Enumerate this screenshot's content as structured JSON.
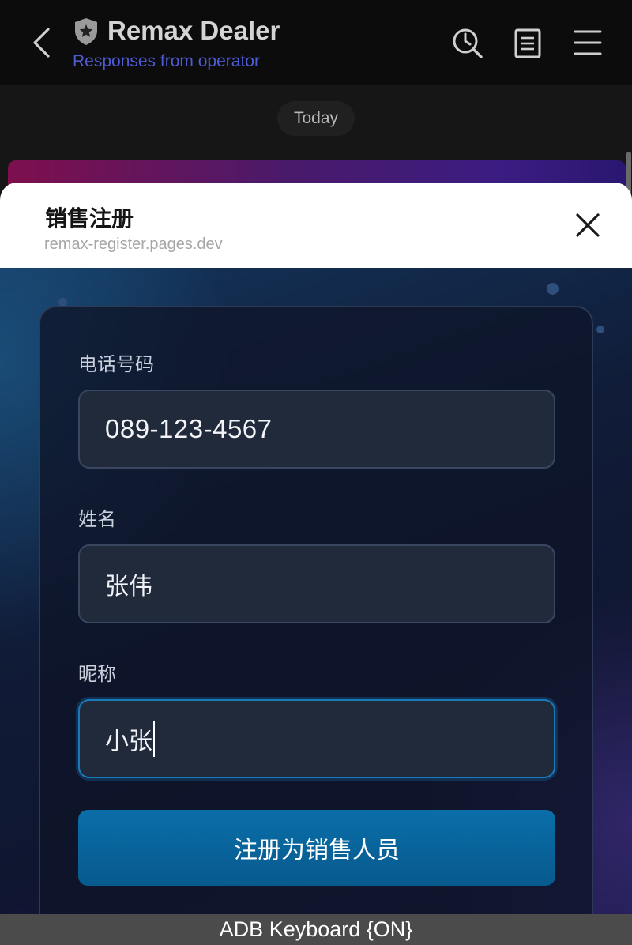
{
  "chat_header": {
    "title": "Remax Dealer",
    "subtitle": "Responses from operator",
    "icons": [
      "chevron-left-icon",
      "shield-star-icon",
      "history-search-icon",
      "document-icon",
      "menu-icon"
    ]
  },
  "chat": {
    "date_divider": "Today"
  },
  "sheet": {
    "title": "销售注册",
    "url": "remax-register.pages.dev",
    "close_icon": "close-icon"
  },
  "form": {
    "phone": {
      "label": "电话号码",
      "value": "089-123-4567"
    },
    "name": {
      "label": "姓名",
      "value": "张伟"
    },
    "nickname": {
      "label": "昵称",
      "value": "小张"
    },
    "submit_label": "注册为销售人员"
  },
  "keyboard_status": "ADB Keyboard {ON}",
  "colors": {
    "header_bg": "#0c0c0c",
    "subtitle": "#4f5bd4",
    "sheet_header_bg": "#ffffff",
    "input_bg": "#212a3b",
    "input_focus_border": "#1a7ab9",
    "button_bg": "#0a6ea9",
    "keyboard_bar_bg": "#4b4b4b"
  }
}
